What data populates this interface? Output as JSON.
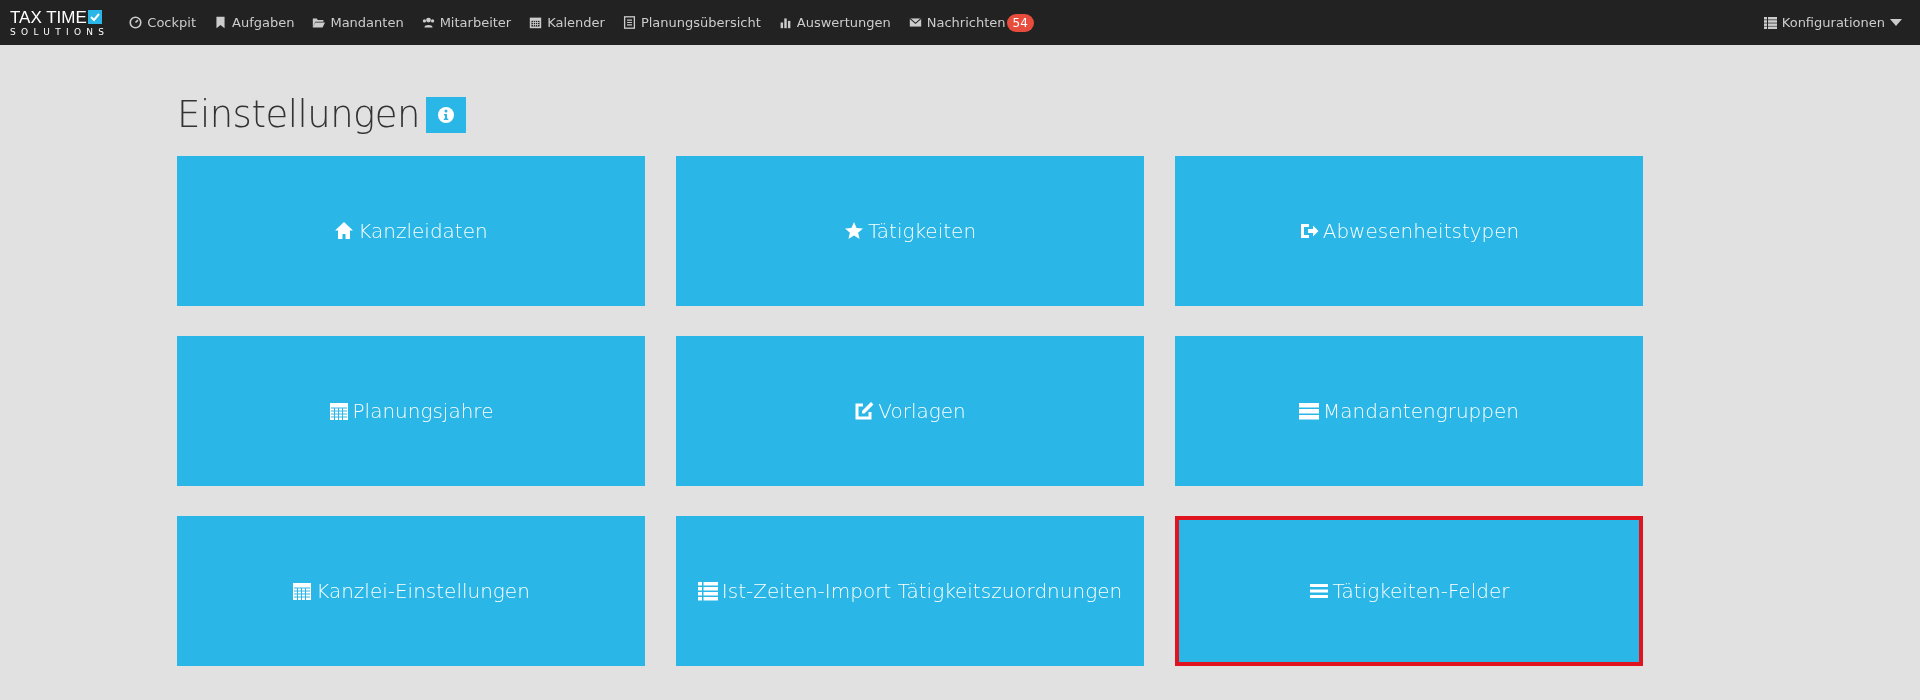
{
  "brand": {
    "line1": "TAX TIME",
    "line2": "SOLUTIONS"
  },
  "nav": [
    {
      "label": "Cockpit",
      "kind": "gauge"
    },
    {
      "label": "Aufgaben",
      "kind": "bookmark"
    },
    {
      "label": "Mandanten",
      "kind": "folder"
    },
    {
      "label": "Mitarbeiter",
      "kind": "users"
    },
    {
      "label": "Kalender",
      "kind": "calendar"
    },
    {
      "label": "Planungsübersicht",
      "kind": "doc"
    },
    {
      "label": "Auswertungen",
      "kind": "chart"
    },
    {
      "label": "Nachrichten",
      "kind": "envelope",
      "badge": "54"
    }
  ],
  "config_menu": {
    "label": "Konfigurationen"
  },
  "page_title": "Einstellungen",
  "tiles": [
    {
      "label": "Kanzleidaten",
      "kind": "home",
      "highlighted": false
    },
    {
      "label": "Tätigkeiten",
      "kind": "star",
      "highlighted": false
    },
    {
      "label": "Abwesenheitstypen",
      "kind": "exit",
      "highlighted": false
    },
    {
      "label": "Planungsjahre",
      "kind": "calendar",
      "highlighted": false
    },
    {
      "label": "Vorlagen",
      "kind": "edit",
      "highlighted": false
    },
    {
      "label": "Mandantengruppen",
      "kind": "server",
      "highlighted": false
    },
    {
      "label": "Kanzlei-Einstellungen",
      "kind": "calendar",
      "highlighted": false
    },
    {
      "label": "Ist-Zeiten-Import Tätigkeitszuordnungen",
      "kind": "list",
      "highlighted": false
    },
    {
      "label": "Tätigkeiten-Felder",
      "kind": "bars",
      "highlighted": true
    }
  ]
}
